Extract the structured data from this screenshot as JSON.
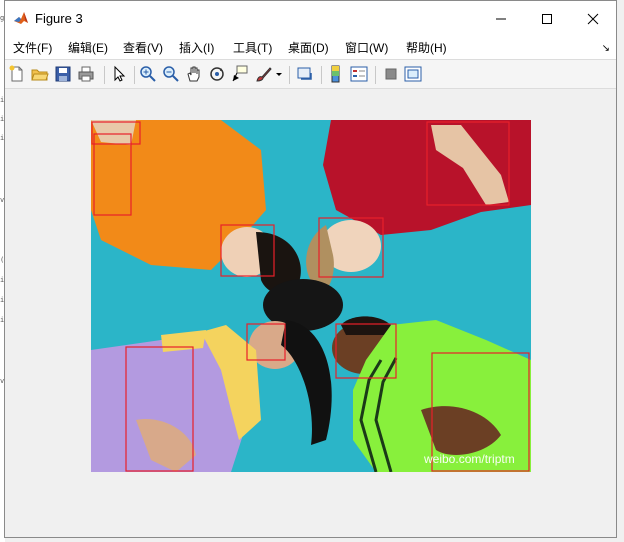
{
  "window": {
    "title": "Figure 3"
  },
  "menu": {
    "items": [
      {
        "id": "file",
        "label": "文件(F)"
      },
      {
        "id": "edit",
        "label": "编辑(E)"
      },
      {
        "id": "view",
        "label": "查看(V)"
      },
      {
        "id": "insert",
        "label": "插入(I)"
      },
      {
        "id": "tools",
        "label": "工具(T)"
      },
      {
        "id": "desktop",
        "label": "桌面(D)"
      },
      {
        "id": "window",
        "label": "窗口(W)"
      },
      {
        "id": "help",
        "label": "帮助(H)"
      }
    ]
  },
  "toolbar": {
    "icons": [
      "new-figure-icon",
      "open-file-icon",
      "save-icon",
      "print-icon",
      "select-arrow-icon",
      "zoom-in-icon",
      "zoom-out-icon",
      "pan-hand-icon",
      "rotate-3d-icon",
      "data-cursor-icon",
      "brush-icon",
      "link-plot-icon",
      "colorbar-icon",
      "legend-icon",
      "hide-plot-tools-icon",
      "show-plot-tools-icon"
    ]
  },
  "figure": {
    "watermark": "weibo.com/triptm",
    "colors": {
      "sky": "#2bb5c8",
      "orange": "#f28a18",
      "red": "#b8122a",
      "purple": "#b39ae0",
      "green": "#88f03c",
      "box": "#e8202a"
    }
  },
  "left_strip": {
    "glyphs": [
      "g",
      "i",
      "i",
      "i",
      "v",
      "(",
      "i",
      "i",
      "i",
      "v"
    ]
  }
}
